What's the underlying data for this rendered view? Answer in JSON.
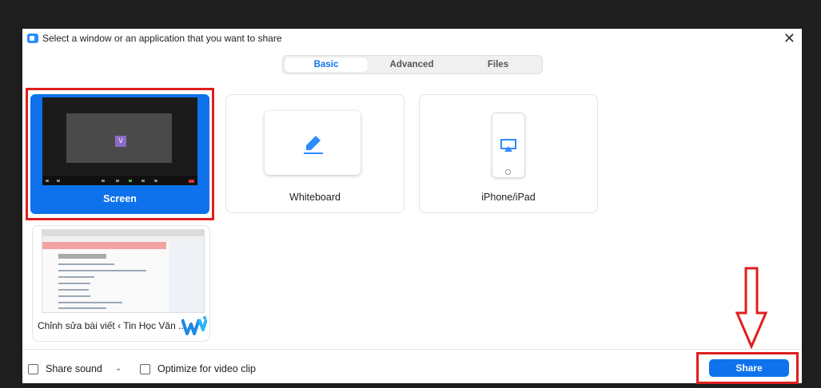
{
  "window": {
    "title": "Select a window or an application that you want to share",
    "close_glyph": "✕",
    "app_icon": "zoom-camera-icon"
  },
  "tabs": [
    {
      "label": "Basic",
      "active": true
    },
    {
      "label": "Advanced",
      "active": false
    },
    {
      "label": "Files",
      "active": false
    }
  ],
  "tiles": {
    "screen": {
      "label": "Screen",
      "thumbnail_letter": "V",
      "selected": true
    },
    "whiteboard": {
      "label": "Whiteboard",
      "icon": "pen-icon"
    },
    "iphone": {
      "label": "iPhone/iPad",
      "icon": "airplay-icon"
    },
    "window": {
      "label": "Chỉnh sửa bài viết ‹ Tin Học Văn ...",
      "icon": "w-logo-icon"
    }
  },
  "footer": {
    "share_sound_label": "Share sound",
    "share_sound_checked": false,
    "optimize_label": "Optimize for video clip",
    "optimize_checked": false,
    "share_button": "Share"
  },
  "colors": {
    "accent": "#0e72ed",
    "highlight": "#e01e1e",
    "backdrop": "#1e1e1e"
  }
}
